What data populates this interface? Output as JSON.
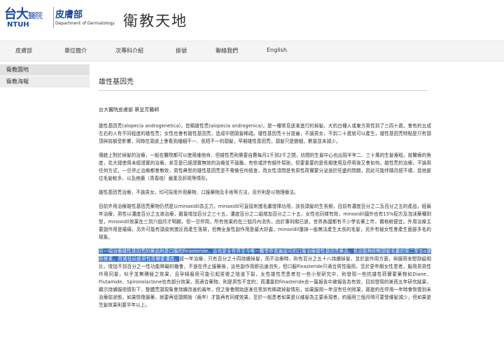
{
  "header": {
    "logo_cn": "台大",
    "logo_cn_small": "醫院",
    "logo_en": "NTUH",
    "dept_name": "皮膚部",
    "dept_en": "Department of Dermatology",
    "banner": "衛教天地"
  },
  "nav": {
    "items": [
      "皮膚部",
      "單位簡介",
      "次專科介紹",
      "掛號",
      "聯絡我們",
      "English"
    ]
  },
  "sidebar": {
    "items": [
      "衛教園地",
      "衛教海報"
    ]
  },
  "article": {
    "title": "雄性基因禿",
    "author": "台大醫院皮膚部 蔡呈芳醫師",
    "p1": "雄性基因禿(alopecia androgenetica)，皆稱雄性禿(alopecia androgenica)，是一種常見逐漸進行的掉髮。大約白種人或東方男性到了三四十歲，會有約五成左右的人有不同程度的雄性禿；女性也會有雄性基因禿，造成中間頭髮稀疏。雄性基因禿十分普遍，不論男女，不到二十歲就可以產生，雄性基因禿特點是只有頭頂與前額受影響，同時在頭皮上會看到細細不一、長短不一的頭髮，早期雄性基因禿，頭髮只是變細，數量並未減少。",
    "p2": "傳統上對於掉髮的治療，一般在醫院都可以使用維他命、但雄性禿則需要自費每月1千到2千之間，坊間的生髮中心也出現半年二、三十萬的生髮療程，就醫療的角度，花大錢使用未經證實的治療，甚至是已經證實無效的治療並不鼓勵，有些或許有額外幫助，但要重要的是長期使用及停用後又會如何。雄性禿的治療，不論用任何方式，一旦停止治療都會無效，男性典型的雄性基因禿並不需做任何檢查，而女性須問是有男性荷爾蒙分泌過於旺盛的問題，因此可能伴隨月經不順，其他部位毛髮較多，以及痤瘡（青春痘）嚴重及肝斑等情形。",
    "p3": "雄性基因禿治療，不論男女，均可採用外用藥物、口服藥物及手術等方法，另外則是以物理療法。",
    "p4": "目前外用治療雄性基因禿藥物仍然是以minoxidil為主力，minoxidil可直接刺激毛囊發揮功用，該長頭髮的生長期，目前有濃度百分之二及百分之五的產品，經兩年治療，男性以濃度百分之五液治療，雖量增加百分之三十五，濃度百分之二組增加百分之二十五，女性也同樣有效，minoxidil國外也有15%配方及泡沫藥種劑型，minoxidil效果在三到六個月才明顯，但一旦停用，所有效果約在三個月內消失，由於專利期已過，世界各國都有不少學名藥上市，價格較便宜。外用治療主要副作用是癢痛，另外可能有頭皮刺激反而產生落屑，但無全身性副作用是最大好處，minoxidil還抹一般無法產生太長的毛髮，另外有極女性會產生面部多毛的現象。",
    "p5_hl": "另一項治療雄性基因禿的藥品則是口服的finasteride，這也是全世界至今唯一醫學界普遍認可的口服治療雄性基因禿藥品，長治能夠抑制頭髮毛囊的第二型五α還原酵素，而減低局部男性荷爾蒙濃度。",
    "p5_rest": "經一年治療，只有百分之十四持續掉髮，而不治療時，則有百分之五十八持續掉髮，並於副作用方面，與服用安慰劑組相比，增加不到百分之一性功能障礙的機會，不過在停止服藥後，這些副作用即迅速消失，但口服Finasteride只適合男性服用，至於更年期女性患者，服用男男性作用同量，似乎並無積極之效果，且孕婦服用可能引起男嬰之陰道下裂，女性雄性禿患者在一些小型研究中，則發現一些抗雄性荷爾蒙藥物如Diane、Flutamide、Spironolactone也有部分效果，而適合藥物，則是男性不宜的；而濃量的finasteride去一篇報告中被報告為有效，目前發現的美而五年研究結果，顯示持續服用情形下，整體禿頭現象會持續改善約兩年，但之後會開始逐漸往喪到有稀疏掉髮情形，如果服用一年沒有任何效果，那麼約在停用一年時會恢復到未治療前狀態，如果恢復服藥，就要再從頭開始（兩年）才能再有同樣效果，至於一般患者如果是以維髮為主要表現者，約服用三個月時可要發維髮減少，但如果是生髮效果則要半年以上。"
  }
}
